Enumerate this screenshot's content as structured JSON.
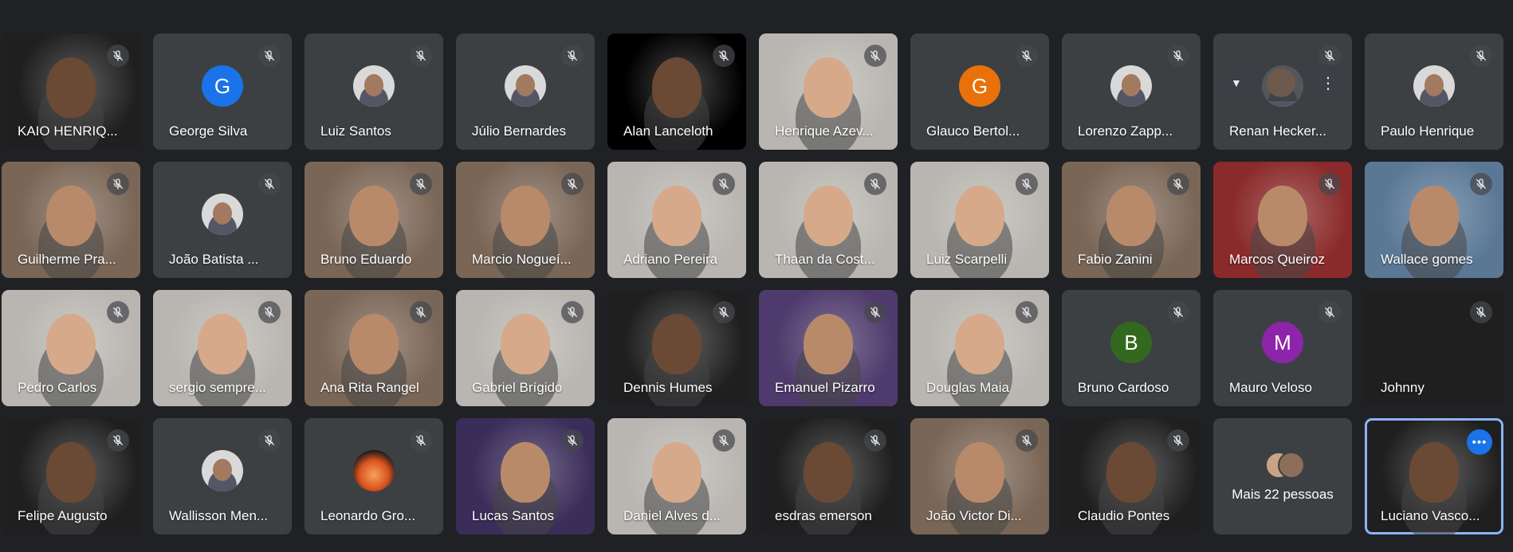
{
  "participants": [
    {
      "name": "KAIO HENRIQ...",
      "kind": "video",
      "tone": "dark",
      "muted": true
    },
    {
      "name": "George Silva",
      "kind": "letter",
      "letter": "G",
      "color": "#1a73e8",
      "muted": true
    },
    {
      "name": "Luiz Santos",
      "kind": "photo",
      "muted": true
    },
    {
      "name": "Júlio Bernardes",
      "kind": "photo",
      "muted": true
    },
    {
      "name": "Alan Lanceloth",
      "kind": "video",
      "tone": "black",
      "muted": true
    },
    {
      "name": "Henrique Azev...",
      "kind": "video",
      "tone": "light",
      "muted": true
    },
    {
      "name": "Glauco Bertol...",
      "kind": "letter",
      "letter": "G",
      "color": "#e8710a",
      "muted": true
    },
    {
      "name": "Lorenzo Zapp...",
      "kind": "photo",
      "muted": true
    },
    {
      "name": "Renan Hecker...",
      "kind": "photo",
      "muted": true,
      "hover": true
    },
    {
      "name": "Paulo Henrique",
      "kind": "photo",
      "muted": true
    },
    {
      "name": "Guilherme Pra...",
      "kind": "video",
      "tone": "room",
      "muted": true
    },
    {
      "name": "João Batista ...",
      "kind": "photo",
      "muted": true
    },
    {
      "name": "Bruno Eduardo",
      "kind": "video",
      "tone": "room",
      "muted": true
    },
    {
      "name": "Marcio Nogueí...",
      "kind": "video",
      "tone": "room",
      "muted": true
    },
    {
      "name": "Adriano Pereira",
      "kind": "video",
      "tone": "light",
      "muted": true
    },
    {
      "name": "Thaan da Cost...",
      "kind": "video",
      "tone": "light",
      "muted": true
    },
    {
      "name": "Luiz Scarpelli",
      "kind": "video",
      "tone": "light",
      "muted": true
    },
    {
      "name": "Fabio Zanini",
      "kind": "video",
      "tone": "room",
      "muted": true
    },
    {
      "name": "Marcos Queiroz",
      "kind": "video",
      "tone": "red",
      "muted": true
    },
    {
      "name": "Wallace gomes",
      "kind": "video",
      "tone": "blue",
      "muted": true
    },
    {
      "name": "Pedro Carlos",
      "kind": "video",
      "tone": "light",
      "muted": true
    },
    {
      "name": "sergio sempre...",
      "kind": "video",
      "tone": "light",
      "muted": true
    },
    {
      "name": "Ana Rita Rangel",
      "kind": "video",
      "tone": "room",
      "muted": true
    },
    {
      "name": "Gabriel Brígido",
      "kind": "video",
      "tone": "light",
      "muted": true
    },
    {
      "name": "Dennis Humes",
      "kind": "video",
      "tone": "dark",
      "muted": true
    },
    {
      "name": "Emanuel Pizarro",
      "kind": "video",
      "tone": "neon",
      "muted": true
    },
    {
      "name": "Douglas Maia",
      "kind": "video",
      "tone": "light",
      "muted": true
    },
    {
      "name": "Bruno Cardoso",
      "kind": "letter",
      "letter": "B",
      "color": "#33691e",
      "muted": true
    },
    {
      "name": "Mauro Veloso",
      "kind": "letter",
      "letter": "M",
      "color": "#8e24aa",
      "muted": true
    },
    {
      "name": "Johnny",
      "kind": "none",
      "muted": true
    },
    {
      "name": "Felipe Augusto",
      "kind": "video",
      "tone": "dark",
      "muted": true
    },
    {
      "name": "Wallisson Men...",
      "kind": "photo",
      "muted": true
    },
    {
      "name": "Leonardo Gro...",
      "kind": "sunset",
      "muted": true
    },
    {
      "name": "Lucas Santos",
      "kind": "video",
      "tone": "purple",
      "muted": true
    },
    {
      "name": "Daniel Alves d...",
      "kind": "video",
      "tone": "light",
      "muted": true
    },
    {
      "name": "esdras emerson",
      "kind": "video",
      "tone": "dark",
      "muted": true
    },
    {
      "name": "João Victor Di...",
      "kind": "video",
      "tone": "room",
      "muted": true
    },
    {
      "name": "Claudio Pontes",
      "kind": "video",
      "tone": "dark",
      "muted": true
    },
    {
      "name": "Mais 22 pessoas",
      "kind": "more",
      "muted": false
    },
    {
      "name": "Luciano Vasco...",
      "kind": "video",
      "tone": "dark",
      "muted": false,
      "self": true
    }
  ],
  "icons": {
    "muted": "mic-off-icon",
    "pin": "pin-icon",
    "more": "more-options-icon"
  },
  "colors": {
    "background": "#202124",
    "tile": "#3c4043",
    "active_border": "#8ab4f8",
    "menu_button": "#1a73e8"
  }
}
